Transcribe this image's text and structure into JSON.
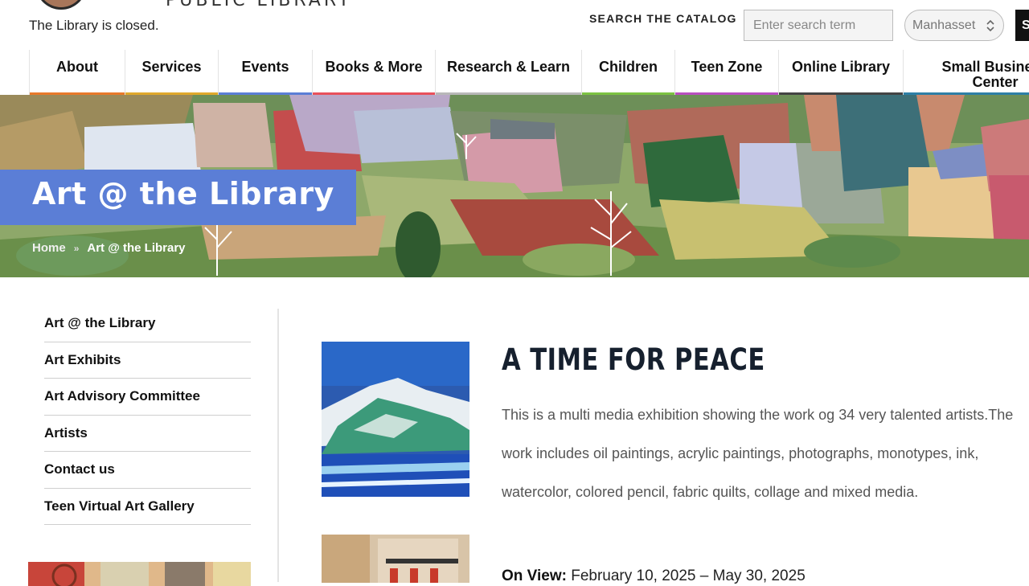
{
  "header": {
    "logo_text": "PUBLIC LIBRARY",
    "status": "The Library is closed.",
    "search_label": "SEARCH THE CATALOG",
    "search_placeholder": "Enter search term",
    "branch": "Manhasset",
    "search_button": "S"
  },
  "nav": [
    {
      "label": "About",
      "color": "#e8792a"
    },
    {
      "label": "Services",
      "color": "#e0a82b"
    },
    {
      "label": "Events",
      "color": "#5b7ed6"
    },
    {
      "label": "Books & More",
      "color": "#e8505b"
    },
    {
      "label": "Research & Learn",
      "color": "#b8b8b8"
    },
    {
      "label": "Children",
      "color": "#7cc242"
    },
    {
      "label": "Teen Zone",
      "color": "#b84fc0"
    },
    {
      "label": "Online Library",
      "color": "#444444"
    },
    {
      "label": "Small Business Center",
      "color": "#2e7fa6"
    }
  ],
  "banner": {
    "title": "Art @ the Library",
    "breadcrumb": {
      "home": "Home",
      "current": "Art @ the Library"
    }
  },
  "sidebar": {
    "items": [
      {
        "label": "Art @ the Library"
      },
      {
        "label": "Art Exhibits"
      },
      {
        "label": "Art Advisory Committee"
      },
      {
        "label": "Artists"
      },
      {
        "label": "Contact us"
      },
      {
        "label": "Teen Virtual Art Gallery"
      }
    ]
  },
  "exhibit": {
    "title": "A TIME FOR PEACE",
    "description": [
      "This is a multi media exhibition showing the work og 34 very talented artists.The",
      "work includes oil paintings, acrylic paintings, photographs, monotypes, ink,",
      "watercolor, colored pencil, fabric quilts, collage and mixed media."
    ],
    "on_view_label": "On View:",
    "on_view_dates": "February 10, 2025 – May 30, 2025"
  }
}
